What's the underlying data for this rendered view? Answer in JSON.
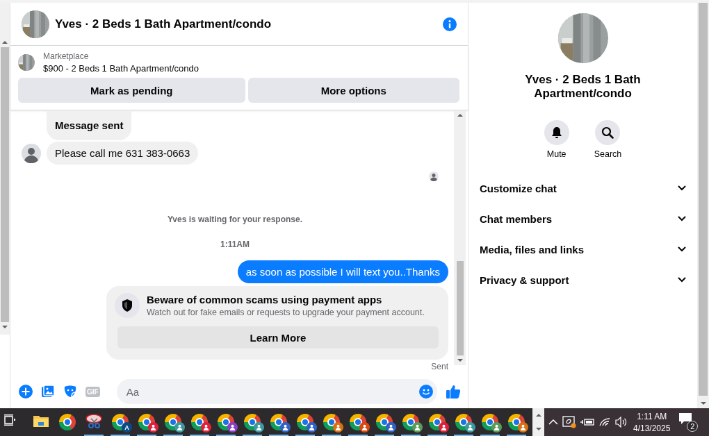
{
  "header": {
    "title": "Yves · 2 Beds 1 Bath Apartment/condo"
  },
  "listing": {
    "source": "Marketplace",
    "summary": "$900 - 2 Beds 1 Bath Apartment/condo",
    "buttons": [
      "Mark as pending",
      "More options"
    ]
  },
  "messages": [
    {
      "kind": "incoming",
      "text": "Message sent",
      "bold": true,
      "avatar": false
    },
    {
      "kind": "incoming",
      "text": "Please call me 631 383-0663",
      "bold": false,
      "avatar": true
    },
    {
      "kind": "seen"
    },
    {
      "kind": "notice",
      "text": "Yves is waiting for your response."
    },
    {
      "kind": "time",
      "text": "1:11AM"
    },
    {
      "kind": "outgoing",
      "text": "as soon as possible I will text you..Thanks"
    },
    {
      "kind": "card",
      "title": "Beware of common scams using payment apps",
      "body": "Watch out for fake emails or requests to upgrade your payment account.",
      "button": "Learn More"
    },
    {
      "kind": "status",
      "text": "Sent"
    }
  ],
  "composer": {
    "gif": "GIF",
    "placeholder": "Aa"
  },
  "profile": {
    "name": "Yves · 2 Beds 1 Bath Apartment/condo",
    "actions": [
      {
        "kind": "mute",
        "label": "Mute"
      },
      {
        "kind": "search",
        "label": "Search"
      }
    ],
    "sections": [
      {
        "label": "Customize chat",
        "expanded": false
      },
      {
        "label": "Chat members",
        "expanded": false
      },
      {
        "label": "Media, files and links",
        "expanded": false
      },
      {
        "label": "Privacy & support",
        "expanded": false
      }
    ]
  },
  "taskbar": {
    "apps": [
      {
        "kind": "folder",
        "running": false
      },
      {
        "kind": "chrome",
        "running": false
      },
      {
        "kind": "snip",
        "running": true
      },
      {
        "kind": "profile",
        "badge": "A",
        "color": "#0b4a85",
        "running": true
      },
      {
        "kind": "profile",
        "color": "#e0203a",
        "running": true
      },
      {
        "kind": "profile",
        "color": "#3a9a9e",
        "running": true
      },
      {
        "kind": "profile",
        "color": "#e0203a",
        "running": true
      },
      {
        "kind": "profile",
        "color": "#8a3fc4",
        "running": true
      },
      {
        "kind": "profile",
        "color": "#3a9a9e",
        "running": true
      },
      {
        "kind": "profile",
        "color": "#2f62c8",
        "running": true
      },
      {
        "kind": "profile",
        "color": "#2f62c8",
        "running": true
      },
      {
        "kind": "profile",
        "color": "#d9700f",
        "running": true
      },
      {
        "kind": "profile",
        "color": "#d9480f",
        "running": true
      },
      {
        "kind": "profile",
        "color": "#2f62c8",
        "running": true
      },
      {
        "kind": "profile",
        "color": "#5a9a5a",
        "running": true
      },
      {
        "kind": "profile",
        "color": "#e0203a",
        "running": true
      },
      {
        "kind": "profile",
        "color": "#3a9a9e",
        "running": true
      },
      {
        "kind": "profile",
        "color": "#5a9a5a",
        "running": true
      },
      {
        "kind": "profile",
        "color": "#d9700f",
        "running": true
      }
    ],
    "time": "1:11 AM",
    "date": "4/13/2025",
    "notifications": "2"
  }
}
